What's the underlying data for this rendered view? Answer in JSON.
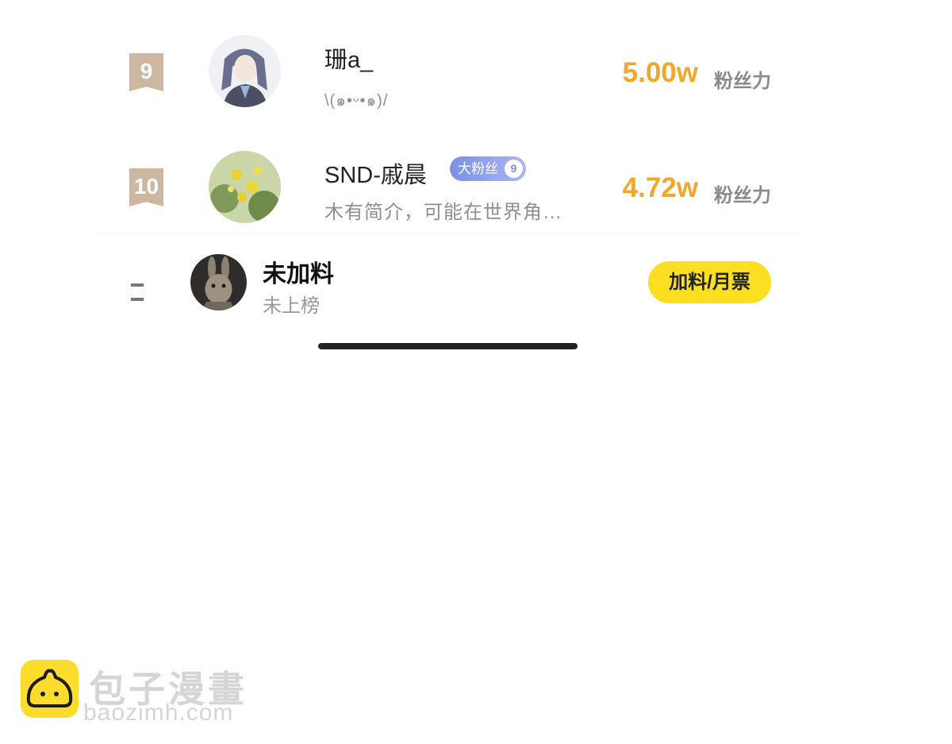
{
  "ranking": [
    {
      "rank": "9",
      "username": "珊a_",
      "bio": "\\(๑•ᵕ•๑)/",
      "score": "5.00w",
      "score_unit": "粉丝力",
      "fan_badge": null
    },
    {
      "rank": "10",
      "username": "SND-戚晨",
      "bio": "木有简介，可能在世界角…",
      "score": "4.72w",
      "score_unit": "粉丝力",
      "fan_badge": {
        "label": "大粉丝",
        "level": "9"
      }
    }
  ],
  "self": {
    "rank": "--",
    "name": "未加料",
    "status": "未上榜",
    "action_label": "加料/月票"
  },
  "watermark": {
    "brand_cn": "包子漫畫",
    "url": "baozimh.com"
  },
  "colors": {
    "score": "#f2a72a",
    "rank_badge": "#cdb7a1",
    "action_button": "#fddf21",
    "fan_badge": "#7c8fe8"
  }
}
